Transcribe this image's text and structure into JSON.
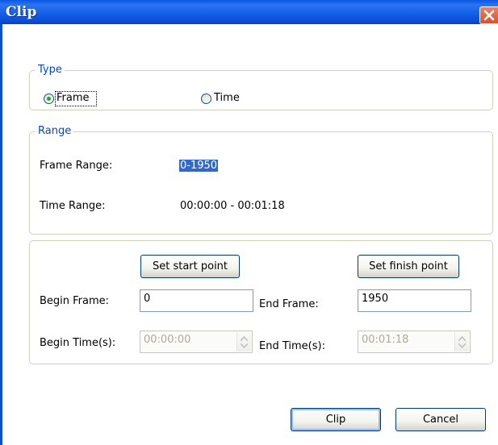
{
  "window": {
    "title": "Clip"
  },
  "type_group": {
    "legend": "Type",
    "options": [
      {
        "label": "Frame",
        "selected": true
      },
      {
        "label": "Time",
        "selected": false
      }
    ]
  },
  "range_group": {
    "legend": "Range",
    "frame_range_label": "Frame Range:",
    "frame_range_value": "0-1950",
    "time_range_label": "Time Range:",
    "time_range_value": "00:00:00 - 00:01:18"
  },
  "clip_group": {
    "set_start_label": "Set start point",
    "set_finish_label": "Set finish point",
    "begin_frame_label": "Begin Frame:",
    "begin_frame_value": "0",
    "end_frame_label": "End Frame:",
    "end_frame_value": "1950",
    "begin_time_label": "Begin Time(s):",
    "begin_time_value": "00:00:00",
    "end_time_label": "End Time(s):",
    "end_time_value": "00:01:18"
  },
  "footer": {
    "clip_label": "Clip",
    "cancel_label": "Cancel"
  },
  "colors": {
    "titlebar": "#0a56e3",
    "legend_text": "#0046d5",
    "selection": "#316ac5",
    "close_button": "#d5532f",
    "radio_dot": "#2ba32b"
  }
}
